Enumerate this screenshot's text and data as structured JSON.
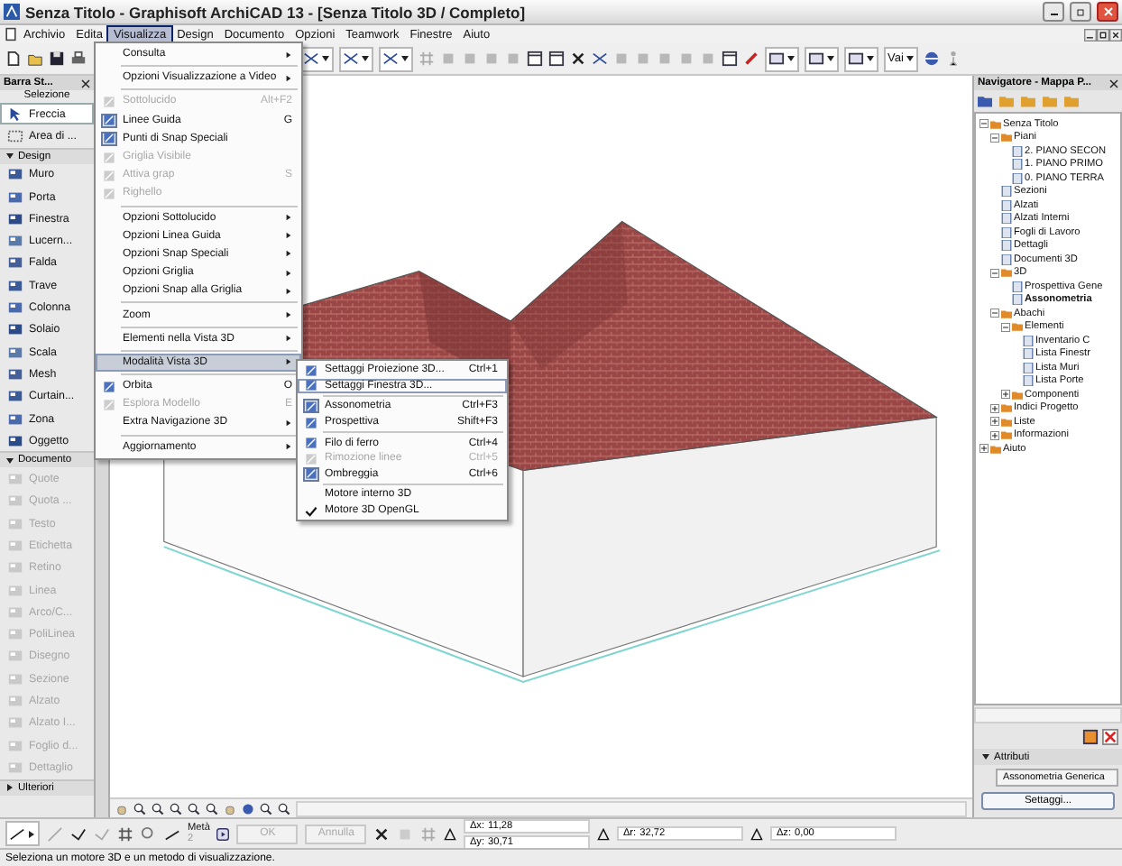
{
  "window": {
    "title": "Senza Titolo - Graphisoft ArchiCAD 13 - [Senza Titolo 3D / Completo]"
  },
  "menubar": [
    {
      "label": "Archivio",
      "selected": false
    },
    {
      "label": "Edita",
      "selected": false
    },
    {
      "label": "Visualizza",
      "selected": true
    },
    {
      "label": "Design",
      "selected": false
    },
    {
      "label": "Documento",
      "selected": false
    },
    {
      "label": "Opzioni",
      "selected": false
    },
    {
      "label": "Teamwork",
      "selected": false
    },
    {
      "label": "Finestre",
      "selected": false
    },
    {
      "label": "Aiuto",
      "selected": false
    }
  ],
  "toolbar": {
    "go_label": "Vai"
  },
  "toolbox": {
    "title": "Barra St...",
    "selection_label": "Selezione",
    "selection_tools": [
      {
        "label": "Freccia",
        "selected": true
      },
      {
        "label": "Area di ...",
        "selected": false
      }
    ],
    "groups": [
      {
        "label": "Design",
        "expanded": true,
        "tools": [
          {
            "label": "Muro",
            "disabled": false
          },
          {
            "label": "Porta",
            "disabled": false
          },
          {
            "label": "Finestra",
            "disabled": false
          },
          {
            "label": "Lucern...",
            "disabled": false
          },
          {
            "label": "Falda",
            "disabled": false
          },
          {
            "label": "Trave",
            "disabled": false
          },
          {
            "label": "Colonna",
            "disabled": false
          },
          {
            "label": "Solaio",
            "disabled": false
          },
          {
            "label": "Scala",
            "disabled": false
          },
          {
            "label": "Mesh",
            "disabled": false
          },
          {
            "label": "Curtain...",
            "disabled": false
          },
          {
            "label": "Zona",
            "disabled": false
          },
          {
            "label": "Oggetto",
            "disabled": false
          }
        ]
      },
      {
        "label": "Documento",
        "expanded": true,
        "tools": [
          {
            "label": "Quote",
            "disabled": true
          },
          {
            "label": "Quota ...",
            "disabled": true
          },
          {
            "label": "Testo",
            "disabled": true
          },
          {
            "label": "Etichetta",
            "disabled": true
          },
          {
            "label": "Retino",
            "disabled": true
          },
          {
            "label": "Linea",
            "disabled": true
          },
          {
            "label": "Arco/C...",
            "disabled": true
          },
          {
            "label": "PoliLinea",
            "disabled": true
          },
          {
            "label": "Disegno",
            "disabled": true
          },
          {
            "label": "Sezione",
            "disabled": true
          },
          {
            "label": "Alzato",
            "disabled": true
          },
          {
            "label": "Alzato I...",
            "disabled": true
          },
          {
            "label": "Foglio d...",
            "disabled": true
          },
          {
            "label": "Dettaglio",
            "disabled": true
          }
        ]
      },
      {
        "label": "Ulteriori",
        "expanded": false
      }
    ]
  },
  "menu": {
    "groups": [
      [
        {
          "label": "Consulta",
          "kind": "command",
          "submenu": true,
          "disabled": false,
          "checked": false,
          "selected": false
        }
      ],
      [
        {
          "label": "Opzioni Visualizzazione a Video",
          "kind": "command",
          "submenu": true,
          "disabled": false,
          "checked": false,
          "selected": false
        }
      ],
      [
        {
          "label": "Sottolucido",
          "shortcut": "Alt+F2",
          "kind": "tool",
          "submenu": false,
          "disabled": true,
          "checked": false,
          "selected": false
        },
        {
          "label": "Linee Guida",
          "shortcut": "G",
          "kind": "tool",
          "submenu": false,
          "disabled": false,
          "checked": true,
          "selected": false
        },
        {
          "label": "Punti di Snap Speciali",
          "kind": "tool",
          "submenu": false,
          "disabled": false,
          "checked": true,
          "selected": false
        },
        {
          "label": "Griglia Visibile",
          "kind": "tool",
          "submenu": false,
          "disabled": true,
          "checked": false,
          "selected": false
        },
        {
          "label": "Attiva grap",
          "shortcut": "S",
          "kind": "tool",
          "submenu": false,
          "disabled": true,
          "checked": false,
          "selected": false
        },
        {
          "label": "Righello",
          "kind": "tool",
          "submenu": false,
          "disabled": true,
          "checked": false,
          "selected": false
        }
      ],
      [
        {
          "label": "Opzioni Sottolucido",
          "kind": "command",
          "submenu": true,
          "disabled": false,
          "checked": false,
          "selected": false
        },
        {
          "label": "Opzioni Linea Guida",
          "kind": "command",
          "submenu": true,
          "disabled": false,
          "checked": false,
          "selected": false
        },
        {
          "label": "Opzioni Snap Speciali",
          "kind": "command",
          "submenu": true,
          "disabled": false,
          "checked": false,
          "selected": false
        },
        {
          "label": "Opzioni Griglia",
          "kind": "command",
          "submenu": true,
          "disabled": false,
          "checked": false,
          "selected": false
        },
        {
          "label": "Opzioni Snap alla Griglia",
          "kind": "command",
          "submenu": true,
          "disabled": false,
          "checked": false,
          "selected": false
        }
      ],
      [
        {
          "label": "Zoom",
          "kind": "command",
          "submenu": true,
          "disabled": false,
          "checked": false,
          "selected": false
        }
      ],
      [
        {
          "label": "Elementi nella Vista 3D",
          "kind": "command",
          "submenu": true,
          "disabled": false,
          "checked": false,
          "selected": false
        }
      ],
      [
        {
          "label": "Modalità Vista 3D",
          "kind": "command",
          "submenu": true,
          "disabled": false,
          "checked": false,
          "selected": true
        }
      ],
      [
        {
          "label": "Orbita",
          "shortcut": "O",
          "kind": "tool",
          "submenu": false,
          "disabled": false,
          "checked": false,
          "selected": false
        },
        {
          "label": "Esplora Modello",
          "shortcut": "E",
          "kind": "tool",
          "submenu": false,
          "disabled": true,
          "checked": false,
          "selected": false
        },
        {
          "label": "Extra Navigazione 3D",
          "kind": "command",
          "submenu": true,
          "disabled": false,
          "checked": false,
          "selected": false
        }
      ],
      [
        {
          "label": "Aggiornamento",
          "kind": "command",
          "submenu": true,
          "disabled": false,
          "checked": false,
          "selected": false
        }
      ]
    ]
  },
  "submenu": {
    "groups": [
      [
        {
          "label": "Settaggi Proiezione 3D...",
          "shortcut": "Ctrl+1",
          "kind": "tool",
          "disabled": false,
          "checked": false,
          "selected": false
        },
        {
          "label": "Settaggi Finestra 3D...",
          "kind": "tool",
          "disabled": false,
          "checked": false,
          "selected": true
        }
      ],
      [
        {
          "label": "Assonometria",
          "shortcut": "Ctrl+F3",
          "kind": "tool",
          "disabled": false,
          "checked": true,
          "selected": false
        },
        {
          "label": "Prospettiva",
          "shortcut": "Shift+F3",
          "kind": "tool",
          "disabled": false,
          "checked": false,
          "selected": false
        }
      ],
      [
        {
          "label": "Filo di ferro",
          "shortcut": "Ctrl+4",
          "kind": "tool",
          "disabled": false,
          "checked": false,
          "selected": false
        },
        {
          "label": "Rimozione linee",
          "shortcut": "Ctrl+5",
          "kind": "tool",
          "disabled": true,
          "checked": false,
          "selected": false
        },
        {
          "label": "Ombreggia",
          "shortcut": "Ctrl+6",
          "kind": "tool",
          "disabled": false,
          "checked": true,
          "selected": false
        }
      ],
      [
        {
          "label": "Motore interno 3D",
          "kind": "command",
          "disabled": false,
          "checked": false,
          "selected": false
        },
        {
          "label": "Motore 3D OpenGL",
          "kind": "command",
          "disabled": false,
          "checked": true,
          "selected": false
        }
      ]
    ]
  },
  "navigator": {
    "title": "Navigatore - Mappa P...",
    "tree": [
      {
        "label": "Senza Titolo",
        "kind": "folder",
        "expanded": true,
        "selected": false,
        "children": [
          {
            "label": "Piani",
            "kind": "folder",
            "expanded": true,
            "selected": false,
            "children": [
              {
                "label": "2. PIANO SECON",
                "kind": "leaf",
                "selected": false
              },
              {
                "label": "1. PIANO PRIMO",
                "kind": "leaf",
                "selected": false
              },
              {
                "label": "0. PIANO TERRA",
                "kind": "leaf",
                "selected": false
              }
            ]
          },
          {
            "label": "Sezioni",
            "kind": "leaf",
            "selected": false
          },
          {
            "label": "Alzati",
            "kind": "leaf",
            "selected": false
          },
          {
            "label": "Alzati Interni",
            "kind": "leaf",
            "selected": false
          },
          {
            "label": "Fogli di Lavoro",
            "kind": "leaf",
            "selected": false
          },
          {
            "label": "Dettagli",
            "kind": "leaf",
            "selected": false
          },
          {
            "label": "Documenti 3D",
            "kind": "leaf",
            "selected": false
          },
          {
            "label": "3D",
            "kind": "folder",
            "expanded": true,
            "selected": false,
            "children": [
              {
                "label": "Prospettiva Gene",
                "kind": "leaf",
                "selected": false
              },
              {
                "label": "Assonometria",
                "kind": "leaf",
                "selected": true
              }
            ]
          },
          {
            "label": "Abachi",
            "kind": "folder",
            "expanded": true,
            "selected": false,
            "children": [
              {
                "label": "Elementi",
                "kind": "folder",
                "expanded": true,
                "selected": false,
                "children": [
                  {
                    "label": "Inventario C",
                    "kind": "leaf",
                    "selected": false
                  },
                  {
                    "label": "Lista Finestr",
                    "kind": "leaf",
                    "selected": false
                  },
                  {
                    "label": "Lista Muri",
                    "kind": "leaf",
                    "selected": false
                  },
                  {
                    "label": "Lista Porte",
                    "kind": "leaf",
                    "selected": false
                  }
                ]
              },
              {
                "label": "Componenti",
                "kind": "folder",
                "expanded": false,
                "selected": false
              }
            ]
          },
          {
            "label": "Indici Progetto",
            "kind": "folder",
            "expanded": false,
            "selected": false
          },
          {
            "label": "Liste",
            "kind": "folder",
            "expanded": false,
            "selected": false
          },
          {
            "label": "Informazioni",
            "kind": "folder",
            "expanded": false,
            "selected": false
          }
        ]
      },
      {
        "label": "Aiuto",
        "kind": "folder",
        "expanded": false,
        "selected": false
      }
    ]
  },
  "attributes": {
    "label": "Attributi",
    "expanded": true,
    "view_name": "Assonometria Generica",
    "button": "Settaggi..."
  },
  "info_box": {
    "snap_label": "Metà",
    "snap_value": "2",
    "buttons": [
      {
        "label": "OK",
        "disabled": true
      },
      {
        "label": "Annulla",
        "disabled": true
      }
    ],
    "coordinate_groups": [
      [
        {
          "label": "Δx:",
          "value": "11,28"
        },
        {
          "label": "Δy:",
          "value": "30,71"
        }
      ],
      [
        {
          "label": "Δr:",
          "value": "32,72"
        }
      ],
      [
        {
          "label": "Δz:",
          "value": "0,00"
        }
      ]
    ]
  },
  "status_bar": "Seleziona un motore 3D e un metodo di visualizzazione."
}
